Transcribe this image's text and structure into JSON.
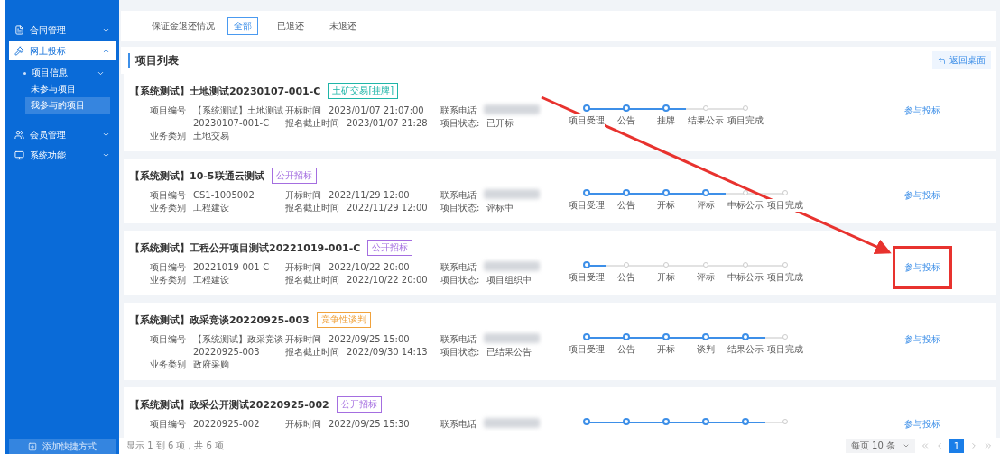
{
  "sidebar": {
    "items": [
      {
        "label": "合同管理",
        "expanded": false,
        "selected": false
      },
      {
        "label": "网上投标",
        "expanded": true,
        "selected": true,
        "children": [
          {
            "label": "项目信息",
            "children": [
              {
                "label": "未参与项目",
                "selected": false
              },
              {
                "label": "我参与的项目",
                "selected": true
              }
            ]
          }
        ]
      },
      {
        "label": "会员管理",
        "expanded": false,
        "selected": false
      },
      {
        "label": "系统功能",
        "expanded": false,
        "selected": false
      }
    ],
    "shortcut_button": "添加快捷方式"
  },
  "filter": {
    "label": "保证金退还情况",
    "options": [
      {
        "label": "全部",
        "selected": true
      },
      {
        "label": "已退还",
        "selected": false
      },
      {
        "label": "未退还",
        "selected": false
      }
    ]
  },
  "list": {
    "title": "项目列表",
    "back_button": "返回桌面",
    "projects": [
      {
        "title": "【系统测试】土地测试20230107-001-C",
        "tag": "土矿交易[挂牌]",
        "color": "#1fb5a8",
        "fields_1": [
          [
            "项目编号",
            "【系统测试】土地测试 20230107-001-C"
          ],
          [
            "业务类别",
            "土地交易"
          ]
        ],
        "fields_2": [
          [
            "开标时间",
            "2023/01/07 21:07:00"
          ],
          [
            "报名截止时间",
            "2023/01/07 21:28"
          ]
        ],
        "phone_label": "联系电话",
        "status_label": "项目状态:",
        "status": "已开标",
        "steps": [
          {
            "label": "项目受理",
            "reached": true
          },
          {
            "label": "公告",
            "reached": true
          },
          {
            "label": "挂牌",
            "reached": true
          },
          {
            "label": "结果公示",
            "reached": false
          },
          {
            "label": "项目完成",
            "reached": false
          }
        ],
        "action": "参与投标",
        "highlighted": false
      },
      {
        "title": "【系统测试】10-5联通云测试",
        "tag": "公开招标",
        "color": "#a46ee0",
        "fields_1": [
          [
            "项目编号",
            "CS1-1005002"
          ],
          [
            "业务类别",
            "工程建设"
          ]
        ],
        "fields_2": [
          [
            "开标时间",
            "2022/11/29 12:00"
          ],
          [
            "报名截止时间",
            "2022/11/29 12:00"
          ]
        ],
        "phone_label": "联系电话",
        "status_label": "项目状态:",
        "status": "评标中",
        "steps": [
          {
            "label": "项目受理",
            "reached": true
          },
          {
            "label": "公告",
            "reached": true
          },
          {
            "label": "开标",
            "reached": true
          },
          {
            "label": "评标",
            "reached": true
          },
          {
            "label": "中标公示",
            "reached": false
          },
          {
            "label": "项目完成",
            "reached": false
          }
        ],
        "action": "参与投标",
        "highlighted": false
      },
      {
        "title": "【系统测试】工程公开项目测试20221019-001-C",
        "tag": "公开招标",
        "color": "#a46ee0",
        "fields_1": [
          [
            "项目编号",
            "20221019-001-C"
          ],
          [
            "业务类别",
            "工程建设"
          ]
        ],
        "fields_2": [
          [
            "开标时间",
            "2022/10/22 20:00"
          ],
          [
            "报名截止时间",
            "2022/10/22 20:00"
          ]
        ],
        "phone_label": "联系电话",
        "status_label": "项目状态:",
        "status": "项目组织中",
        "steps": [
          {
            "label": "项目受理",
            "reached": true
          },
          {
            "label": "公告",
            "reached": false
          },
          {
            "label": "开标",
            "reached": false
          },
          {
            "label": "评标",
            "reached": false
          },
          {
            "label": "中标公示",
            "reached": false
          },
          {
            "label": "项目完成",
            "reached": false
          }
        ],
        "action": "参与投标",
        "highlighted": true
      },
      {
        "title": "【系统测试】政采竞谈20220925-003",
        "tag": "竞争性谈判",
        "color": "#f0a23c",
        "fields_1": [
          [
            "项目编号",
            "【系统测试】政采竞谈 20220925-003"
          ],
          [
            "业务类别",
            "政府采购"
          ]
        ],
        "fields_2": [
          [
            "开标时间",
            "2022/09/25 15:00"
          ],
          [
            "报名截止时间",
            "2022/09/30 14:13"
          ]
        ],
        "phone_label": "联系电话",
        "status_label": "项目状态:",
        "status": "已结果公告",
        "steps": [
          {
            "label": "项目受理",
            "reached": true
          },
          {
            "label": "公告",
            "reached": true
          },
          {
            "label": "开标",
            "reached": true
          },
          {
            "label": "谈判",
            "reached": true
          },
          {
            "label": "结果公示",
            "reached": true
          },
          {
            "label": "项目完成",
            "reached": false
          }
        ],
        "action": "参与投标",
        "highlighted": false
      },
      {
        "title": "【系统测试】政采公开测试20220925-002",
        "tag": "公开招标",
        "color": "#a46ee0",
        "fields_1": [
          [
            "项目编号",
            "20220925-002"
          ]
        ],
        "fields_2": [
          [
            "开标时间",
            "2022/09/25 15:30"
          ]
        ],
        "phone_label": "联系电话",
        "steps": [
          {
            "reached": true
          },
          {
            "reached": true
          },
          {
            "reached": true
          },
          {
            "reached": true
          },
          {
            "reached": true
          },
          {
            "reached": false
          }
        ],
        "action": "参与投标",
        "highlighted": false
      }
    ]
  },
  "footer": {
    "summary": "显示 1 到 6 项，共 6 项",
    "page_size": "每页 10 条",
    "pages": [
      {
        "label": "1",
        "selected": true
      }
    ]
  }
}
